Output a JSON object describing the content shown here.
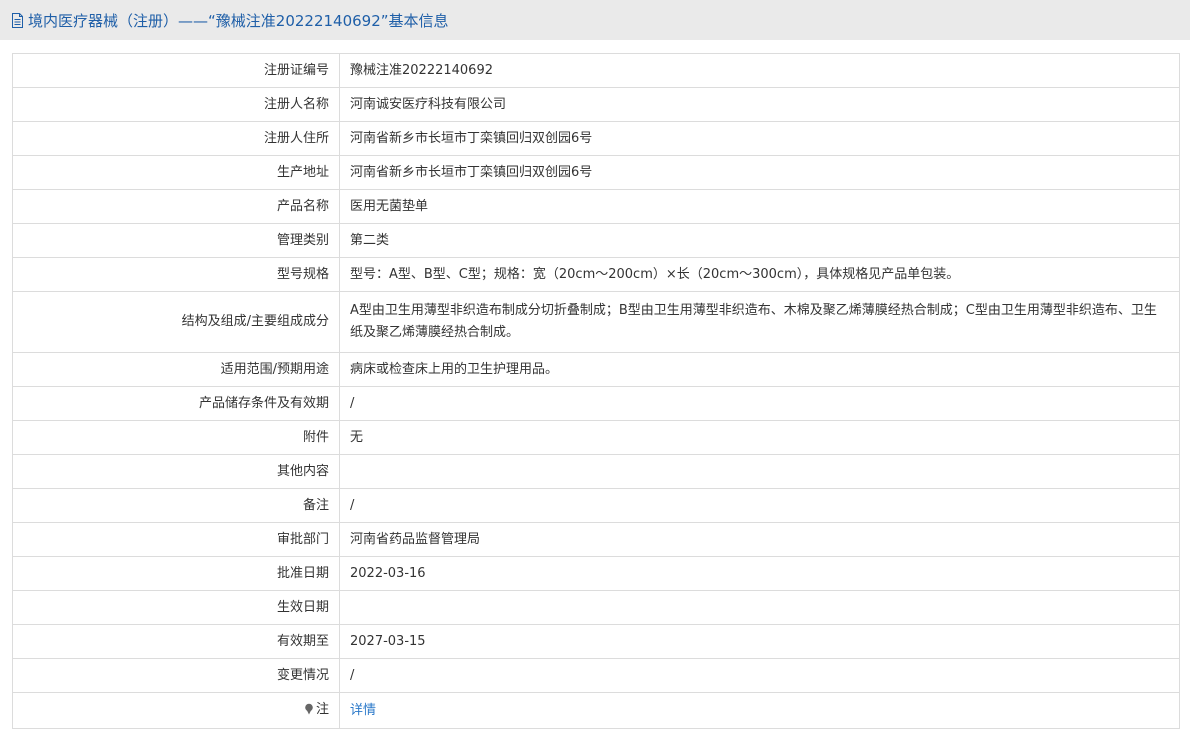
{
  "header": {
    "title": "境内医疗器械（注册）——“豫械注准20222140692”基本信息"
  },
  "colors": {
    "accent": "#1f5fa8",
    "link": "#2a78c9",
    "header_bg": "#eaeaea",
    "border": "#dcdcdc"
  },
  "icons": {
    "header": "document-icon",
    "note": "pin-icon"
  },
  "rows": [
    {
      "label": "注册证编号",
      "value": "豫械注准20222140692"
    },
    {
      "label": "注册人名称",
      "value": "河南诚安医疗科技有限公司"
    },
    {
      "label": "注册人住所",
      "value": "河南省新乡市长垣市丁栾镇回归双创园6号"
    },
    {
      "label": "生产地址",
      "value": "河南省新乡市长垣市丁栾镇回归双创园6号"
    },
    {
      "label": "产品名称",
      "value": "医用无菌垫单"
    },
    {
      "label": "管理类别",
      "value": "第二类"
    },
    {
      "label": "型号规格",
      "value": "型号：A型、B型、C型；规格：宽（20cm～200cm）×长（20cm～300cm），具体规格见产品单包装。"
    },
    {
      "label": "结构及组成/主要组成成分",
      "value": "A型由卫生用薄型非织造布制成分切折叠制成；B型由卫生用薄型非织造布、木棉及聚乙烯薄膜经热合制成；C型由卫生用薄型非织造布、卫生纸及聚乙烯薄膜经热合制成。"
    },
    {
      "label": "适用范围/预期用途",
      "value": "病床或检查床上用的卫生护理用品。"
    },
    {
      "label": "产品储存条件及有效期",
      "value": "/"
    },
    {
      "label": "附件",
      "value": "无"
    },
    {
      "label": "其他内容",
      "value": ""
    },
    {
      "label": "备注",
      "value": "/"
    },
    {
      "label": "审批部门",
      "value": "河南省药品监督管理局"
    },
    {
      "label": "批准日期",
      "value": "2022-03-16"
    },
    {
      "label": "生效日期",
      "value": ""
    },
    {
      "label": "有效期至",
      "value": "2027-03-15"
    },
    {
      "label": "变更情况",
      "value": "/"
    }
  ],
  "note_row": {
    "label": "注",
    "link_text": "详情"
  }
}
